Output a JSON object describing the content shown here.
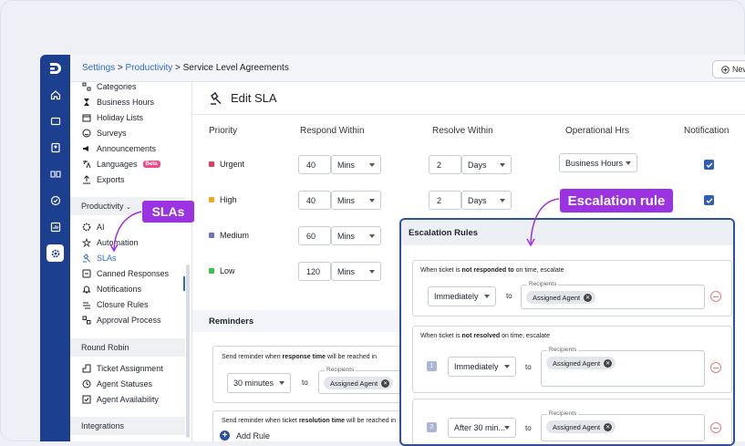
{
  "breadcrumb": {
    "settings": "Settings",
    "sep1": " > ",
    "productivity": "Productivity",
    "sep2": " > ",
    "current": "Service Level Agreements"
  },
  "header": {
    "new_button": "New"
  },
  "sidebar": {
    "top_items": [
      {
        "label": "Categories",
        "icon": "categories-icon"
      },
      {
        "label": "Business Hours",
        "icon": "hourglass-icon"
      },
      {
        "label": "Holiday Lists",
        "icon": "calendar-icon"
      },
      {
        "label": "Surveys",
        "icon": "smile-icon"
      },
      {
        "label": "Announcements",
        "icon": "megaphone-icon"
      },
      {
        "label": "Languages",
        "icon": "translate-icon",
        "badge": "Beta"
      },
      {
        "label": "Exports",
        "icon": "upload-icon"
      }
    ],
    "productivity_header": "Productivity",
    "productivity_items": [
      {
        "label": "AI",
        "icon": "ai-icon"
      },
      {
        "label": "Automation",
        "icon": "automation-icon"
      },
      {
        "label": "SLAs",
        "icon": "gavel-icon"
      },
      {
        "label": "Canned Responses",
        "icon": "canned-icon"
      },
      {
        "label": "Notifications",
        "icon": "bell-icon"
      },
      {
        "label": "Closure Rules",
        "icon": "rules-icon"
      },
      {
        "label": "Approval Process",
        "icon": "approval-icon"
      }
    ],
    "round_robin_header": "Round Robin",
    "round_robin_items": [
      {
        "label": "Ticket Assignment",
        "icon": "assignment-icon"
      },
      {
        "label": "Agent Statuses",
        "icon": "status-icon"
      },
      {
        "label": "Agent Availability",
        "icon": "availability-icon"
      }
    ],
    "integrations_header": "Integrations"
  },
  "page": {
    "title": "Edit SLA"
  },
  "columns": {
    "priority": "Priority",
    "respond": "Respond Within",
    "resolve": "Resolve Within",
    "ophours": "Operational Hrs",
    "notification": "Notification"
  },
  "priorities": [
    {
      "name": "Urgent",
      "color": "#e63c5a",
      "respond": "40",
      "respond_unit": "Mins",
      "resolve": "2",
      "resolve_unit": "Days",
      "ophrs": "Business Hours",
      "notify": true
    },
    {
      "name": "High",
      "color": "#f5a623",
      "respond": "40",
      "respond_unit": "Mins",
      "resolve": "2",
      "resolve_unit": "Days",
      "notify": true
    },
    {
      "name": "Medium",
      "color": "#6a72c9",
      "respond": "60",
      "respond_unit": "Mins"
    },
    {
      "name": "Low",
      "color": "#3cc24a",
      "respond": "120",
      "respond_unit": "Mins"
    }
  ],
  "reminders": {
    "title": "Reminders",
    "response_text_pre": "Send reminder when ",
    "response_text_bold": "response time",
    "response_text_post": " will be reached in",
    "time_value": "30 minutes",
    "to": "to",
    "recipients_label": "Recipients",
    "recipient": "Assigned Agent",
    "resolution_text_pre": "Send reminder when ticket ",
    "resolution_text_bold": "resolution time",
    "resolution_text_post": " will be reached in",
    "add_rule": "Add Rule"
  },
  "escalation": {
    "title": "Escalation Rules",
    "rule1_pre": "When ticket is ",
    "rule1_bold": "not responded to",
    "rule1_post": " on time, escalate",
    "rule1_when": "Immediately",
    "rule2_pre": "When ticket is ",
    "rule2_bold": "not resolved",
    "rule2_post": " on time, escalate",
    "level1": "1",
    "level1_when": "Immediately",
    "level2": "2",
    "level2_when": "After 30 min...",
    "to": "to",
    "recipients_label": "Recipients",
    "recipient": "Assigned Agent"
  },
  "callouts": {
    "slas": "SLAs",
    "escalation": "Escalation rule",
    "color": "#9b33e3"
  }
}
